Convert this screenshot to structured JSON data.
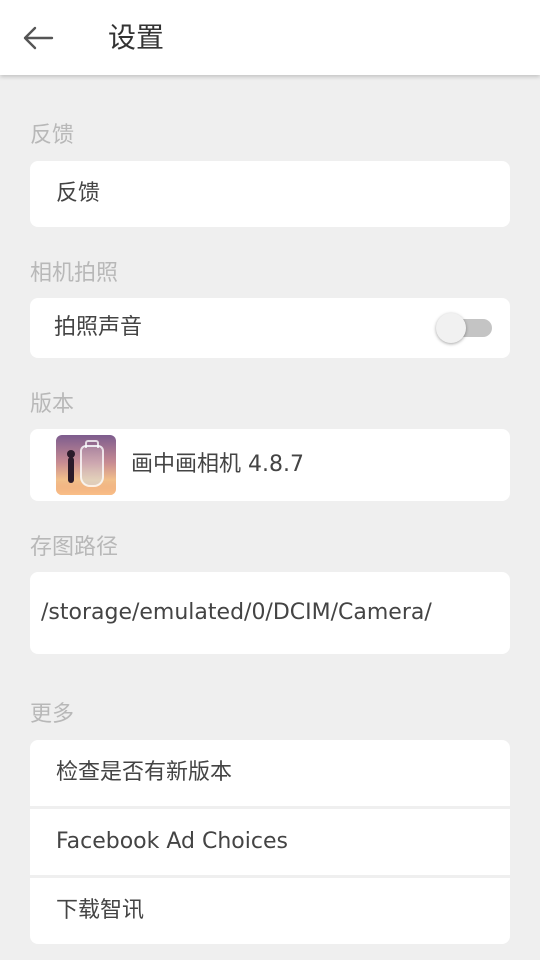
{
  "header": {
    "title": "设置",
    "back_icon": "arrow-left-icon"
  },
  "feedback": {
    "section_label": "反馈",
    "item_label": "反馈"
  },
  "camera": {
    "section_label": "相机拍照",
    "shutter_sound_label": "拍照声音",
    "shutter_sound_on": false
  },
  "version": {
    "section_label": "版本",
    "app_name_version": "画中画相机 4.8.7",
    "app_icon": "app-icon"
  },
  "save_path": {
    "section_label": "存图路径",
    "path": "/storage/emulated/0/DCIM/Camera/"
  },
  "more": {
    "section_label": "更多",
    "items": [
      {
        "label": "检查是否有新版本"
      },
      {
        "label": "Facebook Ad Choices"
      },
      {
        "label": "下载智讯"
      }
    ]
  },
  "colors": {
    "background": "#efefef",
    "card": "#ffffff",
    "section_label": "#b8b8b8",
    "text": "#444444",
    "toggle_off_track": "#c4c4c4"
  }
}
